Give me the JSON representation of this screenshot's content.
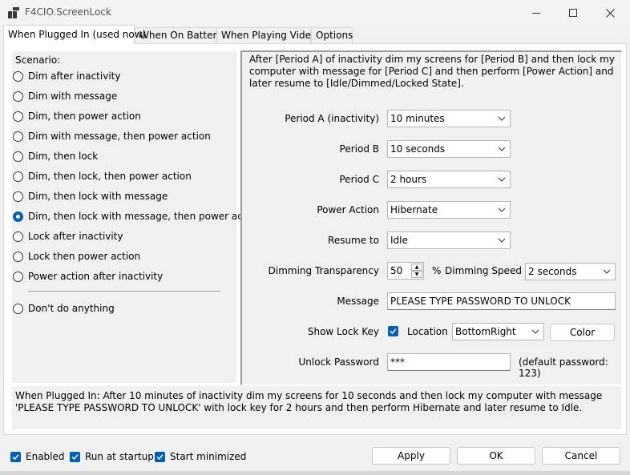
{
  "window": {
    "title": "F4CIO.ScreenLock"
  },
  "tabs": [
    {
      "label": "When Plugged In (used now)",
      "active": true
    },
    {
      "label": "When On Battery",
      "active": false
    },
    {
      "label": "When Playing Video",
      "active": false
    },
    {
      "label": "Options",
      "active": false
    }
  ],
  "scenario": {
    "label": "Scenario:",
    "options": [
      {
        "label": "Dim after inactivity",
        "checked": false
      },
      {
        "label": "Dim with message",
        "checked": false
      },
      {
        "label": "Dim, then power action",
        "checked": false
      },
      {
        "label": "Dim with message, then power action",
        "checked": false
      },
      {
        "label": "Dim, then lock",
        "checked": false
      },
      {
        "label": "Dim, then lock, then power action",
        "checked": false
      },
      {
        "label": "Dim, then lock with message",
        "checked": false
      },
      {
        "label": "Dim, then lock with message, then power action",
        "checked": true
      },
      {
        "label": "Lock after inactivity",
        "checked": false
      },
      {
        "label": "Lock then power action",
        "checked": false
      },
      {
        "label": "Power action after inactivity",
        "checked": false
      }
    ],
    "none_option": {
      "label": "Don't do anything",
      "checked": false
    }
  },
  "settings": {
    "description": "After [Period A] of inactivity dim my screens for [Period B] and then lock my computer with message for [Period C] and then perform [Power Action] and later resume to [Idle/Dimmed/Locked State].",
    "period_a": {
      "label": "Period A (inactivity)",
      "value": "10 minutes"
    },
    "period_b": {
      "label": "Period B",
      "value": "10 seconds"
    },
    "period_c": {
      "label": "Period C",
      "value": "2 hours"
    },
    "power_action": {
      "label": "Power Action",
      "value": "Hibernate"
    },
    "resume_to": {
      "label": "Resume to",
      "value": "Idle"
    },
    "dimming_transparency": {
      "label": "Dimming Transparency",
      "value": "50",
      "unit": "%"
    },
    "dimming_speed": {
      "label": "Dimming Speed",
      "value": "2 seconds"
    },
    "message": {
      "label": "Message",
      "value": "PLEASE TYPE PASSWORD TO UNLOCK"
    },
    "show_lock_key": {
      "label": "Show Lock Key",
      "checked": true
    },
    "location": {
      "label": "Location",
      "value": "BottomRight"
    },
    "color_button": "Color",
    "unlock_password": {
      "label": "Unlock Password",
      "value": "***",
      "hint": "(default password: 123)"
    }
  },
  "summary": "When Plugged In: After 10 minutes of inactivity dim my screens for 10 seconds and then lock my computer with message 'PLEASE TYPE PASSWORD TO UNLOCK' with lock key for 2 hours and then perform Hibernate and later resume to Idle.",
  "footer": {
    "enabled": {
      "label": "Enabled",
      "checked": true
    },
    "run_at_startup": {
      "label": "Run at startup",
      "checked": true
    },
    "start_minimized": {
      "label": "Start minimized",
      "checked": true
    },
    "apply": "Apply",
    "ok": "OK",
    "cancel": "Cancel"
  },
  "colors": {
    "accent": "#005fb8",
    "panel": "#f0f0f0",
    "tab_active": "#ffffff"
  }
}
